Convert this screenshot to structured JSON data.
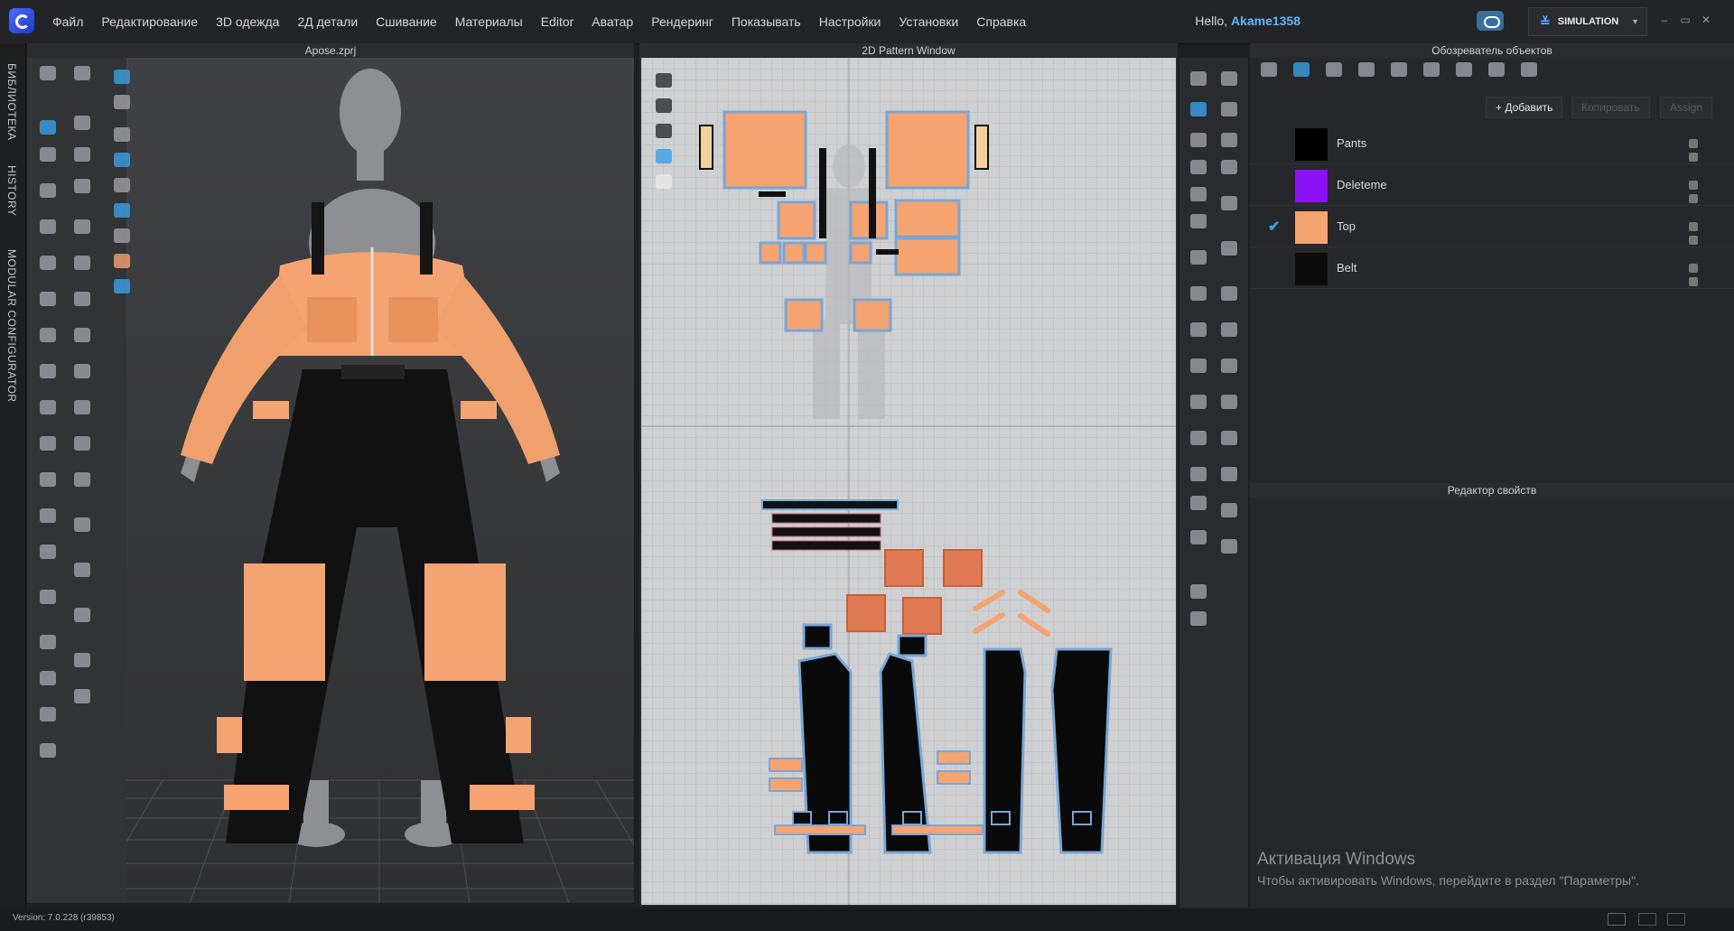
{
  "menu": {
    "items": [
      "Файл",
      "Редактирование",
      "3D одежда",
      "2Д детали",
      "Сшивание",
      "Материалы",
      "Editor",
      "Аватар",
      "Рендеринг",
      "Показывать",
      "Настройки",
      "Установки",
      "Справка"
    ],
    "hello_prefix": "Hello, ",
    "username": "Akame1358",
    "mode": "SIMULATION"
  },
  "vtabs": [
    "БИБЛИОТЕКА",
    "HISTORY",
    "MODULAR CONFIGURATOR"
  ],
  "viewport3d": {
    "title": "Apose.zprj"
  },
  "viewport2d": {
    "title": "2D Pattern Window"
  },
  "object_browser": {
    "title": "Обозреватель объектов",
    "add_label": "+ Добавить",
    "copy_label": "Копировать",
    "assign_label": "Assign",
    "items": [
      {
        "name": "Pants",
        "color": "#000000",
        "checked": false
      },
      {
        "name": "Deleteme",
        "color": "#8a12f5",
        "checked": false
      },
      {
        "name": "Top",
        "color": "#f4a371",
        "checked": true
      },
      {
        "name": "Belt",
        "color": "#0c0c0c",
        "checked": false
      }
    ]
  },
  "property_editor": {
    "title": "Редактор свойств"
  },
  "watermark": {
    "line1": "Активация Windows",
    "line2": "Чтобы активировать Windows, перейдите в раздел \"Параметры\"."
  },
  "status": {
    "version": "Version: 7.0.228 (r39853)"
  },
  "colors": {
    "fabric_orange": "#f4a371",
    "accent": "#3aa0e8",
    "purple": "#8a12f5"
  }
}
